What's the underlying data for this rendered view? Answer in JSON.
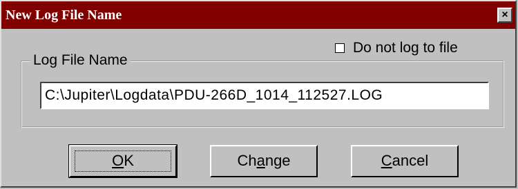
{
  "window": {
    "title": "New Log File Name",
    "close_label": "×"
  },
  "checkbox": {
    "label": "Do not log to file",
    "checked": false
  },
  "group": {
    "legend": "Log File Name"
  },
  "filename_field": {
    "value": "C:\\Jupiter\\Logdata\\PDU-266D_1014_112527.LOG"
  },
  "buttons": {
    "ok": {
      "accel": "O",
      "rest": "K"
    },
    "change": {
      "pre": "Ch",
      "accel": "a",
      "rest": "nge"
    },
    "cancel": {
      "accel": "C",
      "rest": "ancel"
    }
  }
}
